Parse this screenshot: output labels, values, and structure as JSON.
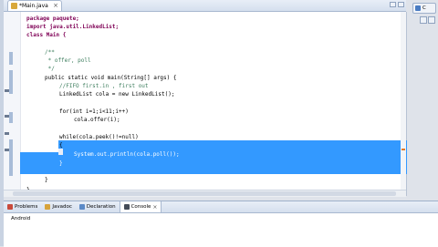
{
  "editor": {
    "tab_label": "*Main.java",
    "lines": [
      {
        "text": "package paquete;",
        "kind": "kw-lead"
      },
      {
        "text": "import java.util.LinkedList;",
        "kind": "kw-lead"
      },
      {
        "text": "class Main {",
        "kind": "kw-lead"
      },
      {
        "text": "/**",
        "kind": "comment"
      },
      {
        "text": " * offer, poll",
        "kind": "comment"
      },
      {
        "text": " */",
        "kind": "comment"
      },
      {
        "text": "public static void main(String[] args) {",
        "kind": "plain"
      },
      {
        "text": "//FIFO first.in , first out",
        "kind": "comment"
      },
      {
        "text": "LinkedList cola = new LinkedList();",
        "kind": "plain"
      },
      {
        "text": "for(int i=1;i<11;i++)",
        "kind": "plain"
      },
      {
        "text": "cola.offer(i);",
        "kind": "plain"
      },
      {
        "text": "while(cola.peek()!=null)",
        "kind": "plain"
      },
      {
        "text": "{",
        "kind": "plain"
      },
      {
        "text": "System.out.println(cola.poll());",
        "kind": "selected"
      },
      {
        "text": "}",
        "kind": "selected"
      },
      {
        "text": "}",
        "kind": "plain"
      },
      {
        "text": "}",
        "kind": "plain"
      }
    ]
  },
  "views": {
    "tabs": [
      "Problems",
      "Javadoc",
      "Declaration",
      "Console"
    ],
    "console_text": "Android"
  },
  "perspective": {
    "label": "C"
  },
  "colors": {
    "selection": "#3399ff",
    "keyword": "#7f0055",
    "comment": "#3f7f5f"
  }
}
